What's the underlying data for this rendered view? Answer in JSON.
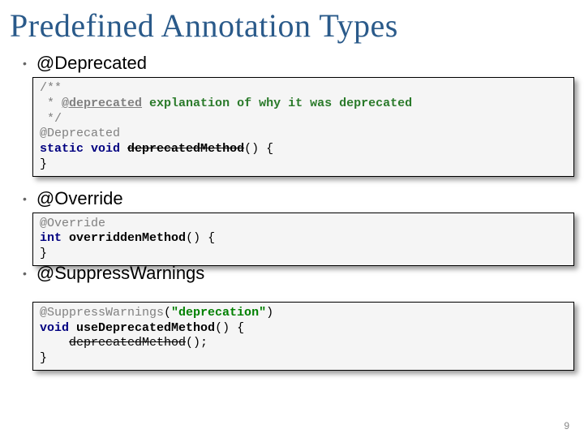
{
  "title": "Predefined Annotation Types",
  "bullets": {
    "deprecated": "@Deprecated",
    "override": "@Override",
    "suppress": "@SuppressWarnings"
  },
  "code": {
    "deprecated": {
      "l1": "/**",
      "l2a": " * ",
      "l2b": "@deprecated",
      "l2c": " explanation of why it was deprecated",
      "l3": " */",
      "l4": "@Deprecated",
      "l5a": "static void",
      "l5b": " ",
      "l5c": "deprecatedMethod",
      "l5d": "() {",
      "l6": "}"
    },
    "override": {
      "l1": "@Override",
      "l2a": "int",
      "l2b": " ",
      "l2c": "overriddenMethod",
      "l2d": "() {",
      "l3": "}"
    },
    "suppress": {
      "l1a": "@SuppressWarnings",
      "l1b": "(",
      "l1c": "\"deprecation\"",
      "l1d": ")",
      "l2a": "void",
      "l2b": " ",
      "l2c": "useDeprecatedMethod",
      "l2d": "() {",
      "l3a": "    ",
      "l3b": "deprecatedMethod",
      "l3c": "();",
      "l4": "}"
    }
  },
  "pageNumber": "9"
}
